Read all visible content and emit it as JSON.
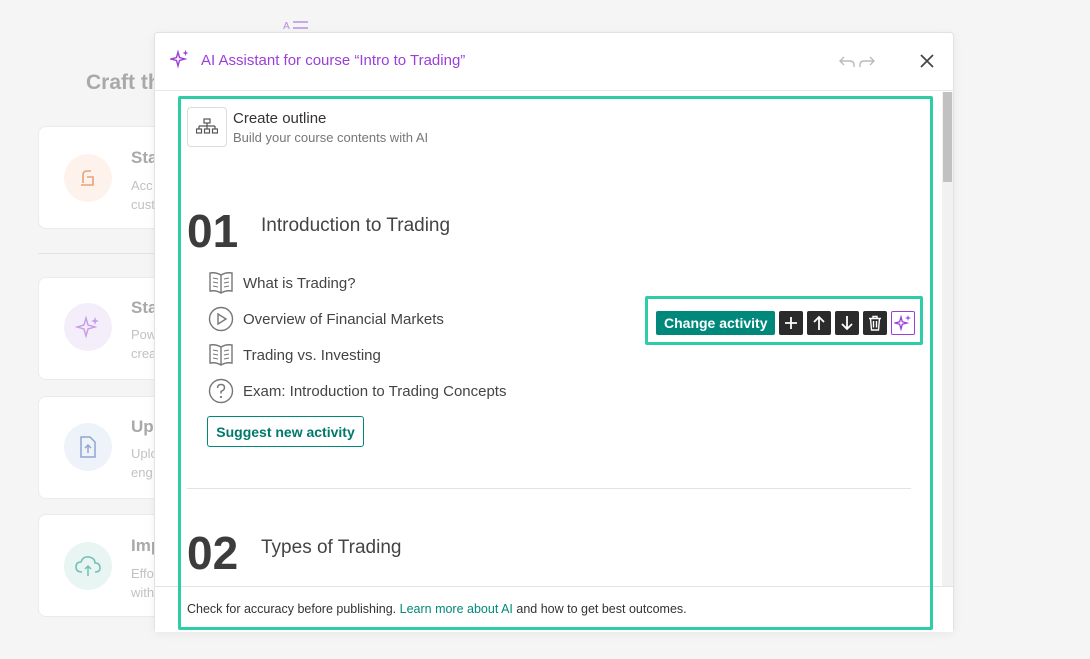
{
  "background": {
    "heading": "Craft th",
    "cards": [
      {
        "title": "Sta",
        "line1": "Acc",
        "line2": "cust",
        "icon": "pen-icon"
      },
      {
        "title": "Sta",
        "line1": "Pow",
        "line2": "crea",
        "icon": "sparkle-icon"
      },
      {
        "title": "Up",
        "line1": "Uplo",
        "line2": "eng",
        "icon": "upload-file-icon"
      },
      {
        "title": "Imp",
        "line1": "Effo",
        "line2": "with",
        "icon": "cloud-upload-icon"
      }
    ]
  },
  "modal": {
    "title": "AI Assistant for course “Intro to Trading”",
    "outline": {
      "title": "Create outline",
      "subtitle": "Build your course contents with AI"
    },
    "sections": [
      {
        "number": "01",
        "title": "Introduction to Trading",
        "activities": [
          {
            "label": "What is Trading?",
            "icon": "book-icon"
          },
          {
            "label": "Overview of Financial Markets",
            "icon": "play-icon"
          },
          {
            "label": "Trading vs. Investing",
            "icon": "book-icon"
          },
          {
            "label": "Exam: Introduction to Trading Concepts",
            "icon": "question-icon"
          }
        ],
        "suggest_label": "Suggest new activity"
      },
      {
        "number": "02",
        "title": "Types of Trading"
      }
    ],
    "toolbar": {
      "change_label": "Change activity"
    },
    "footer": {
      "text_before": "Check for accuracy before publishing. ",
      "link": "Learn more about AI",
      "text_after": " and how to get best outcomes."
    }
  },
  "colors": {
    "accent_teal": "#00897b",
    "ai_purple": "#9b3fd8",
    "highlight": "#2ecda8"
  }
}
